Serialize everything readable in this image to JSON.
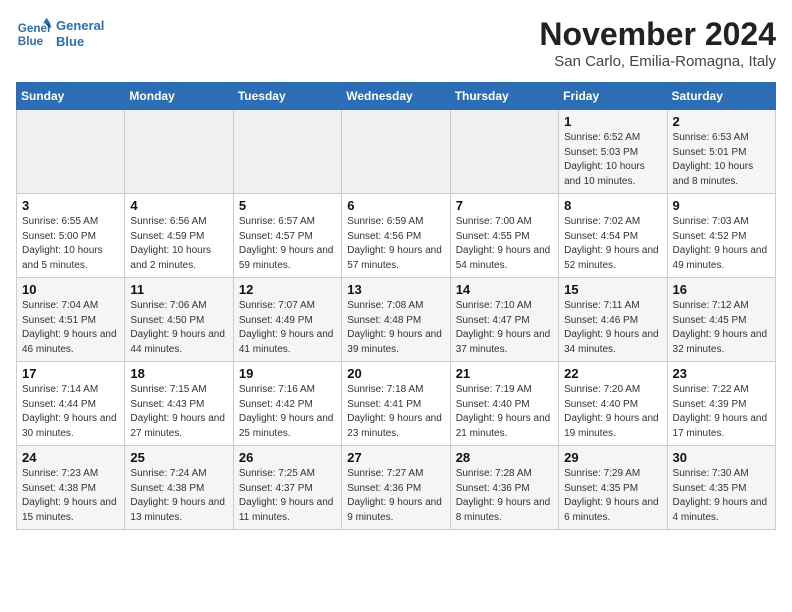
{
  "header": {
    "logo_line1": "General",
    "logo_line2": "Blue",
    "month": "November 2024",
    "location": "San Carlo, Emilia-Romagna, Italy"
  },
  "weekdays": [
    "Sunday",
    "Monday",
    "Tuesday",
    "Wednesday",
    "Thursday",
    "Friday",
    "Saturday"
  ],
  "weeks": [
    [
      {
        "day": "",
        "detail": ""
      },
      {
        "day": "",
        "detail": ""
      },
      {
        "day": "",
        "detail": ""
      },
      {
        "day": "",
        "detail": ""
      },
      {
        "day": "",
        "detail": ""
      },
      {
        "day": "1",
        "detail": "Sunrise: 6:52 AM\nSunset: 5:03 PM\nDaylight: 10 hours and 10 minutes."
      },
      {
        "day": "2",
        "detail": "Sunrise: 6:53 AM\nSunset: 5:01 PM\nDaylight: 10 hours and 8 minutes."
      }
    ],
    [
      {
        "day": "3",
        "detail": "Sunrise: 6:55 AM\nSunset: 5:00 PM\nDaylight: 10 hours and 5 minutes."
      },
      {
        "day": "4",
        "detail": "Sunrise: 6:56 AM\nSunset: 4:59 PM\nDaylight: 10 hours and 2 minutes."
      },
      {
        "day": "5",
        "detail": "Sunrise: 6:57 AM\nSunset: 4:57 PM\nDaylight: 9 hours and 59 minutes."
      },
      {
        "day": "6",
        "detail": "Sunrise: 6:59 AM\nSunset: 4:56 PM\nDaylight: 9 hours and 57 minutes."
      },
      {
        "day": "7",
        "detail": "Sunrise: 7:00 AM\nSunset: 4:55 PM\nDaylight: 9 hours and 54 minutes."
      },
      {
        "day": "8",
        "detail": "Sunrise: 7:02 AM\nSunset: 4:54 PM\nDaylight: 9 hours and 52 minutes."
      },
      {
        "day": "9",
        "detail": "Sunrise: 7:03 AM\nSunset: 4:52 PM\nDaylight: 9 hours and 49 minutes."
      }
    ],
    [
      {
        "day": "10",
        "detail": "Sunrise: 7:04 AM\nSunset: 4:51 PM\nDaylight: 9 hours and 46 minutes."
      },
      {
        "day": "11",
        "detail": "Sunrise: 7:06 AM\nSunset: 4:50 PM\nDaylight: 9 hours and 44 minutes."
      },
      {
        "day": "12",
        "detail": "Sunrise: 7:07 AM\nSunset: 4:49 PM\nDaylight: 9 hours and 41 minutes."
      },
      {
        "day": "13",
        "detail": "Sunrise: 7:08 AM\nSunset: 4:48 PM\nDaylight: 9 hours and 39 minutes."
      },
      {
        "day": "14",
        "detail": "Sunrise: 7:10 AM\nSunset: 4:47 PM\nDaylight: 9 hours and 37 minutes."
      },
      {
        "day": "15",
        "detail": "Sunrise: 7:11 AM\nSunset: 4:46 PM\nDaylight: 9 hours and 34 minutes."
      },
      {
        "day": "16",
        "detail": "Sunrise: 7:12 AM\nSunset: 4:45 PM\nDaylight: 9 hours and 32 minutes."
      }
    ],
    [
      {
        "day": "17",
        "detail": "Sunrise: 7:14 AM\nSunset: 4:44 PM\nDaylight: 9 hours and 30 minutes."
      },
      {
        "day": "18",
        "detail": "Sunrise: 7:15 AM\nSunset: 4:43 PM\nDaylight: 9 hours and 27 minutes."
      },
      {
        "day": "19",
        "detail": "Sunrise: 7:16 AM\nSunset: 4:42 PM\nDaylight: 9 hours and 25 minutes."
      },
      {
        "day": "20",
        "detail": "Sunrise: 7:18 AM\nSunset: 4:41 PM\nDaylight: 9 hours and 23 minutes."
      },
      {
        "day": "21",
        "detail": "Sunrise: 7:19 AM\nSunset: 4:40 PM\nDaylight: 9 hours and 21 minutes."
      },
      {
        "day": "22",
        "detail": "Sunrise: 7:20 AM\nSunset: 4:40 PM\nDaylight: 9 hours and 19 minutes."
      },
      {
        "day": "23",
        "detail": "Sunrise: 7:22 AM\nSunset: 4:39 PM\nDaylight: 9 hours and 17 minutes."
      }
    ],
    [
      {
        "day": "24",
        "detail": "Sunrise: 7:23 AM\nSunset: 4:38 PM\nDaylight: 9 hours and 15 minutes."
      },
      {
        "day": "25",
        "detail": "Sunrise: 7:24 AM\nSunset: 4:38 PM\nDaylight: 9 hours and 13 minutes."
      },
      {
        "day": "26",
        "detail": "Sunrise: 7:25 AM\nSunset: 4:37 PM\nDaylight: 9 hours and 11 minutes."
      },
      {
        "day": "27",
        "detail": "Sunrise: 7:27 AM\nSunset: 4:36 PM\nDaylight: 9 hours and 9 minutes."
      },
      {
        "day": "28",
        "detail": "Sunrise: 7:28 AM\nSunset: 4:36 PM\nDaylight: 9 hours and 8 minutes."
      },
      {
        "day": "29",
        "detail": "Sunrise: 7:29 AM\nSunset: 4:35 PM\nDaylight: 9 hours and 6 minutes."
      },
      {
        "day": "30",
        "detail": "Sunrise: 7:30 AM\nSunset: 4:35 PM\nDaylight: 9 hours and 4 minutes."
      }
    ]
  ]
}
